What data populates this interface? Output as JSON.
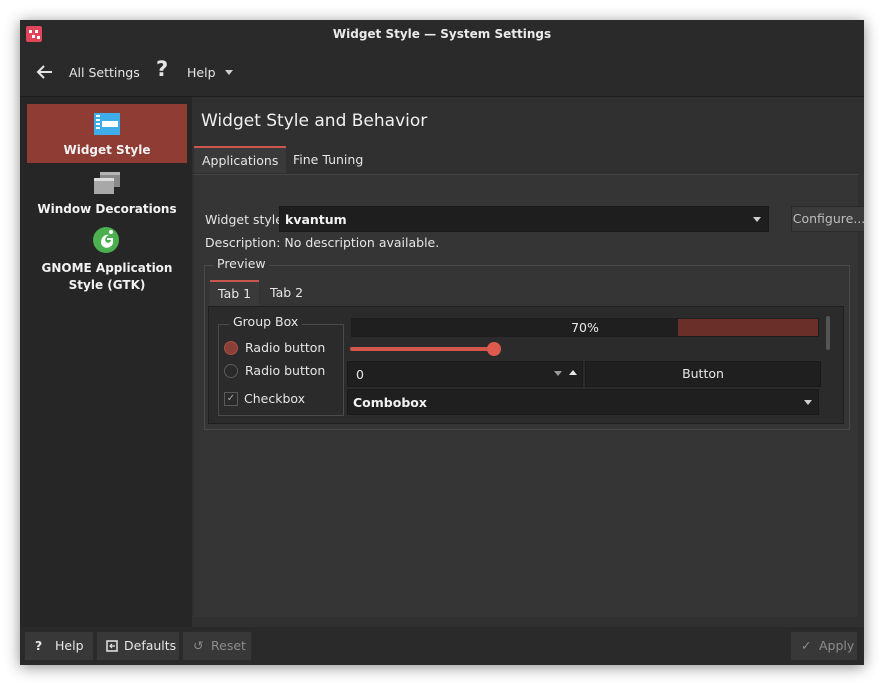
{
  "window": {
    "title": "Widget Style — System Settings"
  },
  "toolbar": {
    "back_icon": "back-arrow-icon",
    "all_settings_label": "All Settings",
    "help_icon": "help-icon",
    "help_label": "Help"
  },
  "sidebar": {
    "items": [
      {
        "label": "Widget Style",
        "icon": "widget-style-icon",
        "active": true
      },
      {
        "label": "Window Decorations",
        "icon": "window-decorations-icon",
        "active": false
      },
      {
        "label": "GNOME Application Style (GTK)",
        "icon": "gnome-icon",
        "active": false
      }
    ]
  },
  "main": {
    "title": "Widget Style and Behavior",
    "tabs": [
      {
        "label": "Applications",
        "active": true
      },
      {
        "label": "Fine Tuning",
        "active": false
      }
    ],
    "widget_style_label": "Widget style:",
    "widget_style_value": "kvantum",
    "configure_label": "Configure...",
    "description_text": "Description: No description available.",
    "preview": {
      "label": "Preview",
      "tabs": [
        {
          "label": "Tab 1",
          "active": true
        },
        {
          "label": "Tab 2",
          "active": false
        }
      ],
      "group_box_label": "Group Box",
      "radio1_label": "Radio button",
      "radio2_label": "Radio button",
      "checkbox_label": "Checkbox",
      "progress_text": "70%",
      "progress_value": 0.7,
      "slider_value": 0.3,
      "spin_value": "0",
      "button_label": "Button",
      "combobox_label": "Combobox"
    }
  },
  "bottom": {
    "help_label": "Help",
    "defaults_label": "Defaults",
    "reset_label": "Reset",
    "apply_label": "Apply"
  },
  "colors": {
    "accent": "#8f3c34",
    "accent_bright": "#d4574c",
    "window_bg": "#2f2f2f"
  }
}
